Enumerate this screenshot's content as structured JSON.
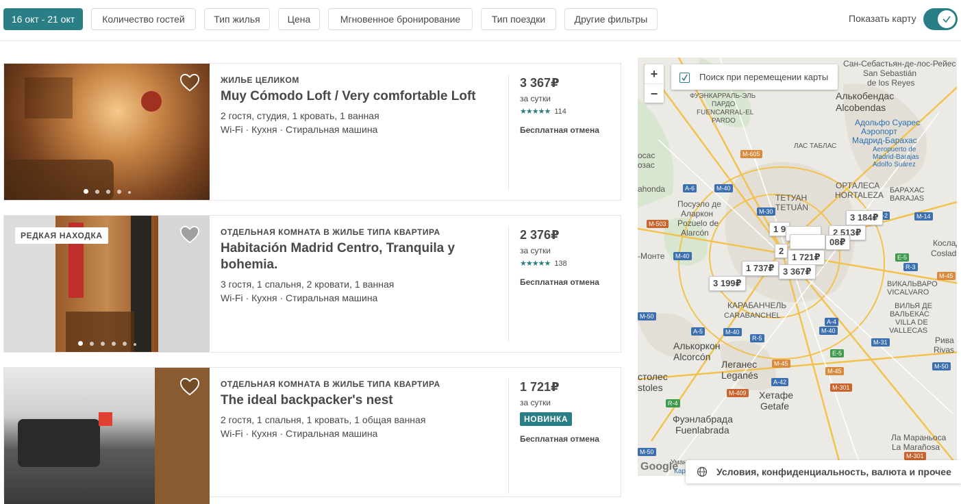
{
  "filters": [
    {
      "label": "16 окт - 21 окт",
      "active": true
    },
    {
      "label": "Количество гостей",
      "active": false
    },
    {
      "label": "Тип жилья",
      "active": false
    },
    {
      "label": "Цена",
      "active": false
    },
    {
      "label": "Мгновенное бронирование",
      "active": false
    },
    {
      "label": "Тип поездки",
      "active": false
    },
    {
      "label": "Другие фильтры",
      "active": false
    }
  ],
  "map_toggle": {
    "label": "Показать карту",
    "on": true
  },
  "listings": [
    {
      "kind": "ЖИЛЬЕ ЦЕЛИКОМ",
      "title": "Muy Cómodo Loft / Very comfortable Loft",
      "details": "2 гостя, студия, 1 кровать, 1 ванная",
      "amenities": "Wi-Fi · Кухня · Стиральная машина",
      "price": "3 367₽",
      "per": "за сутки",
      "stars": "★★★★★",
      "reviews": "114",
      "cancel": "Бесплатная отмена",
      "badge": ""
    },
    {
      "kind": "ОТДЕЛЬНАЯ КОМНАТА В ЖИЛЬЕ ТИПА КВАРТИРА",
      "title": "Habitación Madrid Centro, Tranquila y bohemia.",
      "details": "3 гостя, 1 спальня, 2 кровати, 1 ванная",
      "amenities": "Wi-Fi · Кухня · Стиральная машина",
      "price": "2 376₽",
      "per": "за сутки",
      "stars": "★★★★★",
      "reviews": "138",
      "cancel": "Бесплатная отмена",
      "badge": "РЕДКАЯ НАХОДКА"
    },
    {
      "kind": "ОТДЕЛЬНАЯ КОМНАТА В ЖИЛЬЕ ТИПА КВАРТИРА",
      "title": "The ideal backpacker's nest",
      "details": "2 гостя, 1 спальня, 1 кровать, 1 общая ванная",
      "amenities": "Wi-Fi · Кухня · Стиральная машина",
      "price": "1 721₽",
      "per": "за сутки",
      "new_label": "НОВИНКА",
      "cancel": "Бесплатная отмена"
    }
  ],
  "map": {
    "search_on_move": "Поиск при перемещении карты",
    "zoom_in": "+",
    "zoom_out": "−",
    "pins": [
      "3 184₽",
      "2 513₽",
      "08₽",
      "1 9",
      "2",
      "1 721₽",
      "1 737₽",
      "3 367₽",
      "3 199₽"
    ],
    "labels": [
      "Сан-Себастьян-де-лос-Рейес",
      "San Sebastián",
      "de los Reyes",
      "Алькобендас",
      "Alcobendas",
      "ФУЭНКАРРАЛЬ-ЭЛЬ",
      "ПАРДО",
      "FUENCARRAL-EL",
      "PARDO",
      "Адольфо Суарес",
      "Аэропорт",
      "Мадрид-Барахас",
      "Aeropuerto de",
      "Madrid-Barajas",
      "Adolfo Suárez",
      "ЛАС ТАБЛАС",
      "ОРТАЛЕСА",
      "HORTALEZA",
      "БАРАХАС",
      "BARAJAS",
      "ТЕТУАН",
      "TETUÁN",
      "Посуэло де",
      "Аларкон",
      "Pozuelo de",
      "Alarcón",
      "КАРАБАНЧЕЛЬ",
      "CARABANCHEL",
      "ВИКАЛЬВАРО",
      "VICALVARO",
      "ВИЛЬЯ ДЕ",
      "ВАЛЬЕКАС",
      "VILLA DE",
      "VALLECAS",
      "Алькоркон",
      "Alcorcón",
      "Леганес",
      "Leganés",
      "Хетафе",
      "Getafe",
      "Фуэнлабрада",
      "Fuenlabrada",
      "Ла Мараньоса",
      "La Marañosa",
      "Рива",
      "Rivas",
      "Кослад",
      "Coslad",
      "осас",
      "озас",
      "ahonda",
      "-Монте",
      "столес",
      "stoles",
      "Уманес де",
      "Кар"
    ],
    "roads": [
      "M-605",
      "A-6",
      "M-40",
      "M-30",
      "M-503",
      "M-40",
      "A-2",
      "M-14",
      "E-5",
      "R-3",
      "M-45",
      "A-4",
      "M-40",
      "A-5",
      "M-40",
      "R-5",
      "E-5",
      "M-31",
      "M-50",
      "M-45",
      "M-45",
      "A-42",
      "M-301",
      "M-409",
      "R-4",
      "M-301",
      "M-50",
      "M-50"
    ],
    "google": "Google",
    "footer": "Условия, конфиденциальность, валюта и прочее"
  },
  "colors": {
    "accent": "#2a7e85",
    "text": "#484848",
    "border": "#e4e4e4"
  }
}
